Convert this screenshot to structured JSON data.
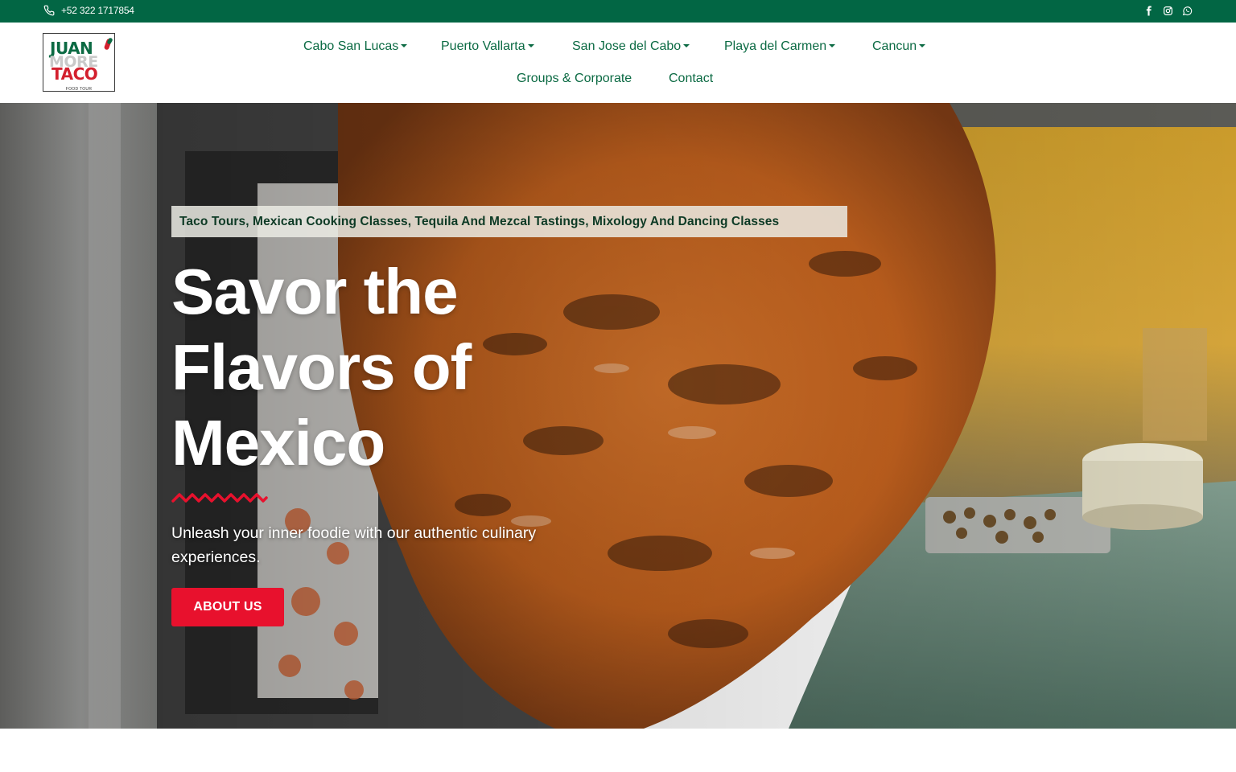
{
  "topbar": {
    "phone": "+52 322 1717854",
    "socials": [
      "facebook-icon",
      "instagram-icon",
      "whatsapp-icon"
    ]
  },
  "logo": {
    "line1": "JUAN",
    "line2": "MORE",
    "line3": "TACO",
    "line4": "FOOD TOUR"
  },
  "nav": {
    "row1": [
      {
        "label": "Cabo San Lucas",
        "dropdown": true
      },
      {
        "label": "Puerto Vallarta",
        "dropdown": true
      },
      {
        "label": "San Jose del Cabo",
        "dropdown": true
      },
      {
        "label": "Playa del Carmen",
        "dropdown": true
      },
      {
        "label": "Cancun",
        "dropdown": true
      }
    ],
    "row2": [
      {
        "label": "Groups & Corporate",
        "dropdown": false
      },
      {
        "label": "Contact",
        "dropdown": false
      }
    ]
  },
  "hero": {
    "tagline": "Taco Tours, Mexican Cooking Classes, Tequila And Mezcal Tastings, Mixology And Dancing Classes",
    "title_line1": "Savor the",
    "title_line2": "Flavors of",
    "title_line3": "Mexico",
    "subtitle": "Unleash your inner foodie with our authentic culinary experiences.",
    "button": "ABOUT US"
  },
  "colors": {
    "brand_green": "#026644",
    "nav_green": "#0b6a43",
    "accent_red": "#e8112d"
  }
}
